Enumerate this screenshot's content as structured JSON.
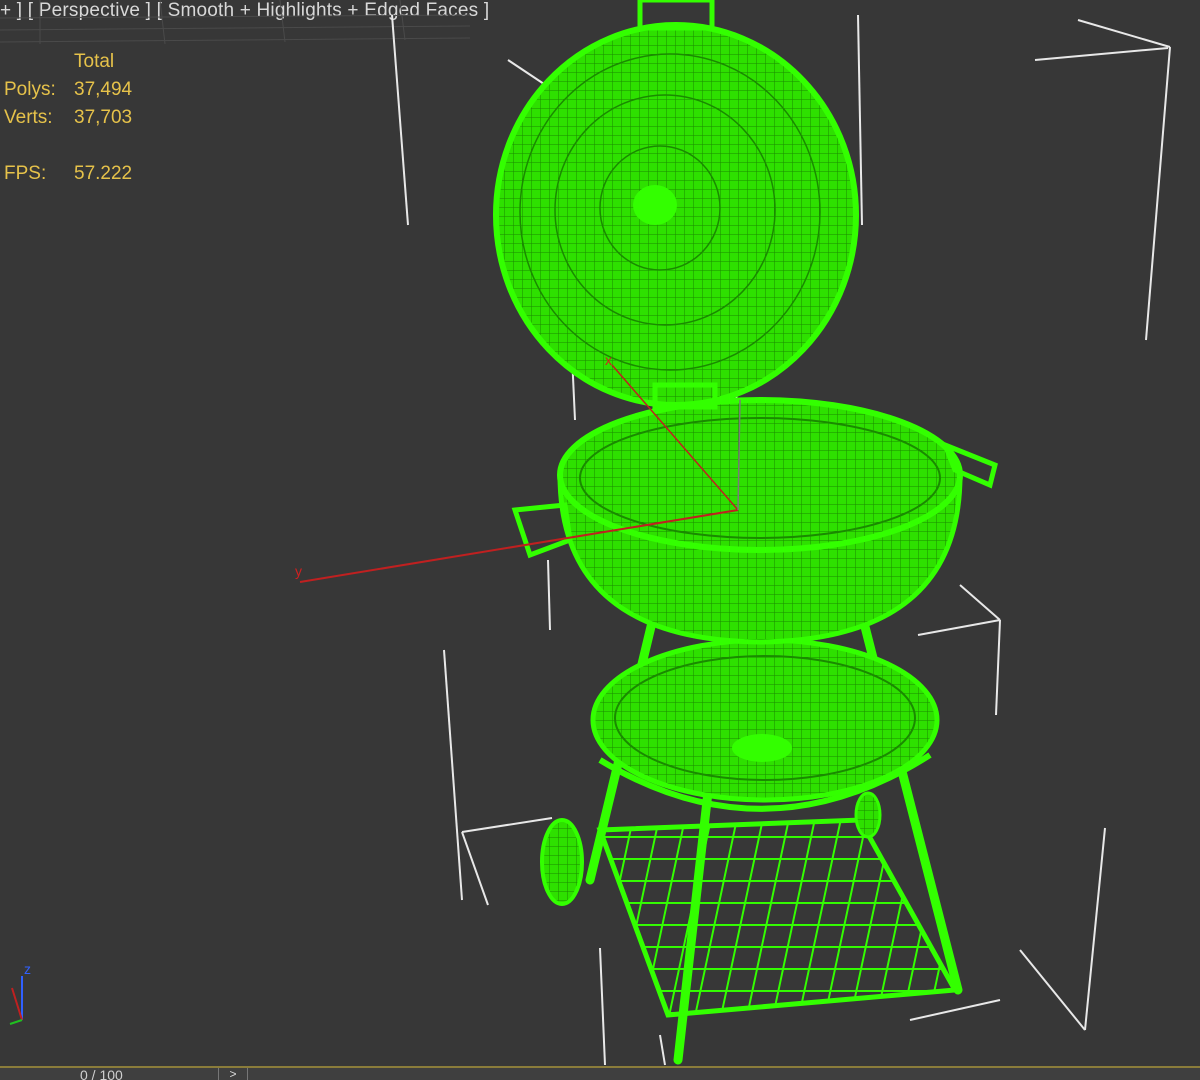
{
  "viewport": {
    "label_parts": [
      "+ ] [ ",
      "Perspective",
      " ] [ ",
      "Smooth + Highlights + Edged Faces",
      " ]"
    ],
    "view_name": "Perspective",
    "shading_mode": "Smooth + Highlights + Edged Faces"
  },
  "stats": {
    "header": "Total",
    "rows": [
      {
        "label": "Polys:",
        "value": "37,494"
      },
      {
        "label": "Verts:",
        "value": "37,703"
      },
      {
        "label": "FPS:",
        "value": "57.222"
      }
    ]
  },
  "gizmo": {
    "x_label": "x",
    "y_label": "y"
  },
  "axis_tripod": {
    "z_label": "z"
  },
  "timeline": {
    "frame": "0 / 100",
    "next_label": ">"
  },
  "colors": {
    "viewport_bg": "#373737",
    "wire": "#33ff00",
    "wire_dark": "#1f9c00",
    "bbox": "#e8e8e8",
    "stats_text": "#e6c24a",
    "axis_x": "#d02020"
  }
}
